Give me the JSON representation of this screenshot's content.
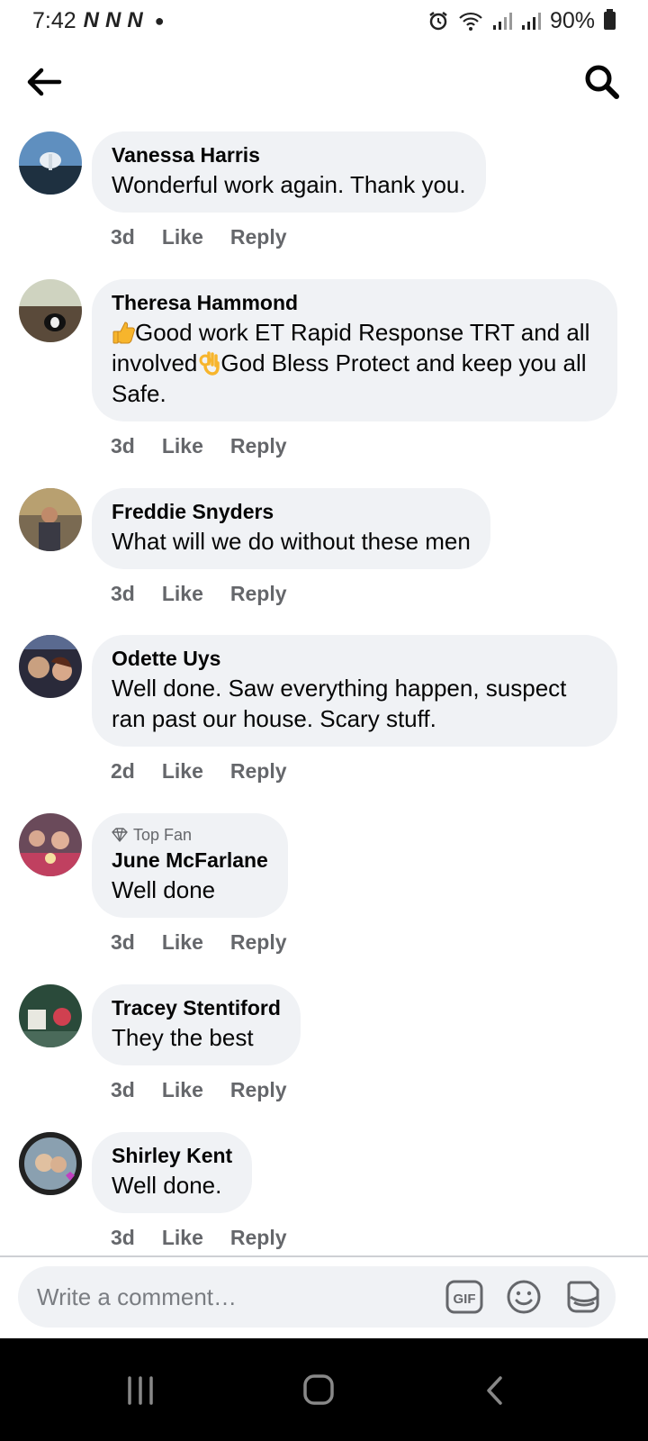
{
  "status_bar": {
    "time": "7:42",
    "notification_icons": [
      "N",
      "N",
      "N"
    ],
    "battery": "90%"
  },
  "nav": {
    "back_icon": "arrow-left-icon",
    "search_icon": "search-icon"
  },
  "comments": [
    {
      "author": "Vanessa Harris",
      "text": "Wonderful work again. Thank you.",
      "time": "3d",
      "like_label": "Like",
      "reply_label": "Reply"
    },
    {
      "author": "Theresa Hammond",
      "text_parts": [
        "Good work ET Rapid Response TRT and all involved",
        "God Bless Protect and keep you all Safe."
      ],
      "time": "3d",
      "like_label": "Like",
      "reply_label": "Reply"
    },
    {
      "author": "Freddie Snyders",
      "text": "What will we do without these men",
      "time": "3d",
      "like_label": "Like",
      "reply_label": "Reply"
    },
    {
      "author": "Odette Uys",
      "text": "Well done. Saw everything happen, suspect ran past our house. Scary stuff.",
      "time": "2d",
      "like_label": "Like",
      "reply_label": "Reply"
    },
    {
      "badge": "Top Fan",
      "author": "June McFarlane",
      "text": "Well done",
      "time": "3d",
      "like_label": "Like",
      "reply_label": "Reply"
    },
    {
      "author": "Tracey Stentiford",
      "text": "They the best",
      "time": "3d",
      "like_label": "Like",
      "reply_label": "Reply"
    },
    {
      "author": "Shirley Kent",
      "text": "Well done.",
      "time": "3d",
      "like_label": "Like",
      "reply_label": "Reply"
    }
  ],
  "composer": {
    "placeholder": "Write a comment…",
    "gif_label": "GIF"
  },
  "colors": {
    "bubble": "#f0f2f5",
    "meta_text": "#65676b"
  }
}
